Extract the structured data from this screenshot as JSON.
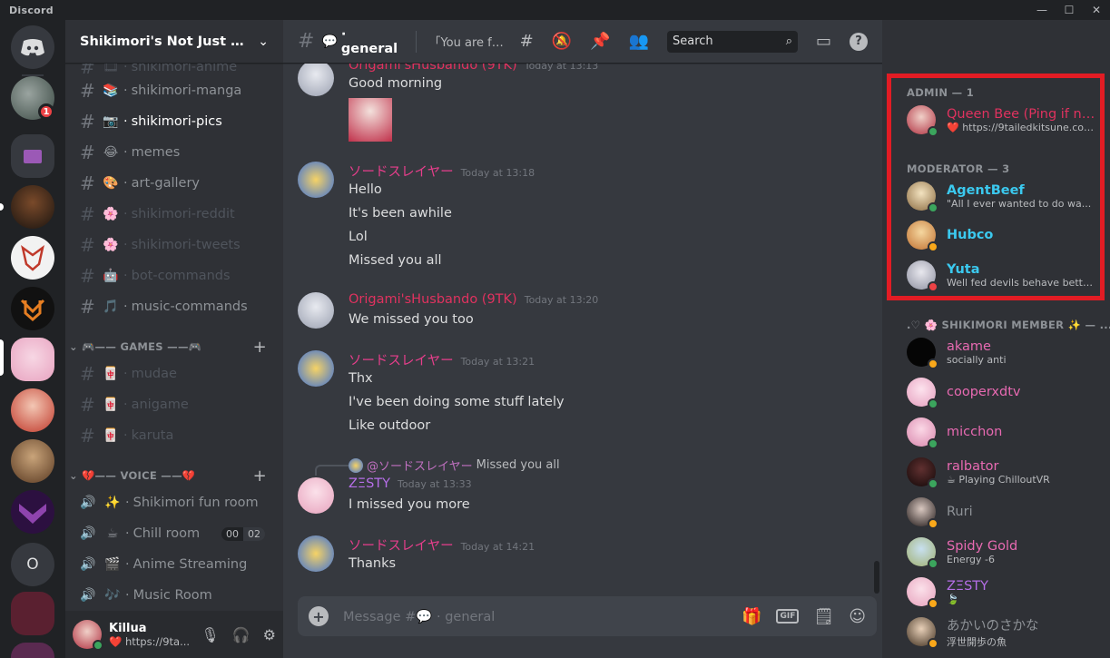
{
  "window": {
    "app_name": "Discord"
  },
  "guilds": {
    "badge_count": "1",
    "text_guild": "O"
  },
  "server": {
    "name": "Shikimori's Not Just a Cu...",
    "channels": [
      {
        "name": "shikimori-anime",
        "emoji": "🎞"
      },
      {
        "name": "shikimori-manga",
        "emoji": "📚"
      },
      {
        "name": "shikimori-pics",
        "emoji": "📷"
      },
      {
        "name": "memes",
        "emoji": "😂"
      },
      {
        "name": "art-gallery",
        "emoji": "🎨"
      },
      {
        "name": "shikimori-reddit",
        "emoji": "🌸"
      },
      {
        "name": "shikimori-tweets",
        "emoji": "🌸"
      },
      {
        "name": "bot-commands",
        "emoji": "🤖"
      },
      {
        "name": "music-commands",
        "emoji": "🎵"
      }
    ],
    "games_category": "🎮—— GAMES ——🎮",
    "games": [
      {
        "name": "mudae",
        "emoji": "🀄"
      },
      {
        "name": "anigame",
        "emoji": "🀄"
      },
      {
        "name": "karuta",
        "emoji": "🀄"
      }
    ],
    "voice_category": "💔—— VOICE ——💔",
    "voice": [
      {
        "name": "Shikimori fun room",
        "emoji": "✨"
      },
      {
        "name": "Chill room",
        "emoji": "☕",
        "count_a": "00",
        "count_b": "02"
      },
      {
        "name": "Anime Streaming",
        "emoji": "🎬"
      },
      {
        "name": "Music Room",
        "emoji": "🎶"
      }
    ]
  },
  "user": {
    "name": "Killua",
    "status": "❤️ https://9ta..."
  },
  "chat": {
    "channel": "general",
    "channel_emoji": "💬",
    "topic": "「You are free to discuss anything that is on your min...",
    "search_placeholder": "Search",
    "composer_placeholder": "Message #💬 · general",
    "messages": [
      {
        "author": "Origami'sHusbando (9TK)",
        "time": "Today at 13:13",
        "lines": [
          "Good morning"
        ],
        "color": "#e0325f"
      },
      {
        "author": "ソードスレイヤー",
        "time": "Today at 13:18",
        "lines": [
          "Hello",
          "It's been awhile",
          "Lol",
          "Missed you all"
        ],
        "color": "#e83e8c"
      },
      {
        "author": "Origami'sHusbando (9TK)",
        "time": "Today at 13:20",
        "lines": [
          "We missed you too"
        ],
        "color": "#e0325f"
      },
      {
        "author": "ソードスレイヤー",
        "time": "Today at 13:21",
        "lines": [
          "Thx",
          "I've been doing some stuff lately",
          "Like outdoor"
        ],
        "color": "#e83e8c"
      },
      {
        "author": "ZΞSTY",
        "time": "Today at 13:33",
        "lines": [
          "I missed you more"
        ],
        "color": "#b66ee8",
        "reply_to": "@ソードスレイヤー",
        "reply_text": "Missed you all"
      },
      {
        "author": "ソードスレイヤー",
        "time": "Today at 14:21",
        "lines": [
          "Thanks"
        ],
        "color": "#e83e8c"
      }
    ]
  },
  "members": {
    "admin_header": "ADMIN — 1",
    "moderator_header": "MODERATOR — 3",
    "member_header": ".♡ 🌸 SHIKIMORI MEMBER ✨ — ...",
    "admins": [
      {
        "name": "Queen Bee (Ping if nee...",
        "status": "❤️ https://9tailedkitsune.com/",
        "color": "#e0325f"
      }
    ],
    "moderators": [
      {
        "name": "AgentBeef",
        "status": "\"All I ever wanted to do wa...",
        "color": "#3bc9ef"
      },
      {
        "name": "Hubco",
        "status": "",
        "color": "#3bc9ef"
      },
      {
        "name": "Yuta",
        "status": "Well fed devils behave better t...",
        "color": "#3bc9ef"
      }
    ],
    "shikimori_members": [
      {
        "name": "akame",
        "status": "socially anti",
        "color": "#e86ab2"
      },
      {
        "name": "cooperxdtv",
        "status": "",
        "color": "#e86ab2"
      },
      {
        "name": "micchon",
        "status": "",
        "color": "#e86ab2"
      },
      {
        "name": "ralbator",
        "status": "☕ Playing ChilloutVR",
        "color": "#e86ab2"
      },
      {
        "name": "Ruri",
        "status": "",
        "color": "#8e9297"
      },
      {
        "name": "Spidy Gold",
        "status": "Energy -6",
        "color": "#e86ab2"
      },
      {
        "name": "ZΞSTY",
        "status": "🍃",
        "color": "#b66ee8"
      },
      {
        "name": "あかいのさかな",
        "status": "浮世開歩の魚",
        "color": "#8e9297"
      }
    ]
  },
  "colors": {
    "online": "#3ba55d",
    "idle": "#faa81a",
    "dnd": "#ed4245",
    "highlight": "#e21c24"
  }
}
